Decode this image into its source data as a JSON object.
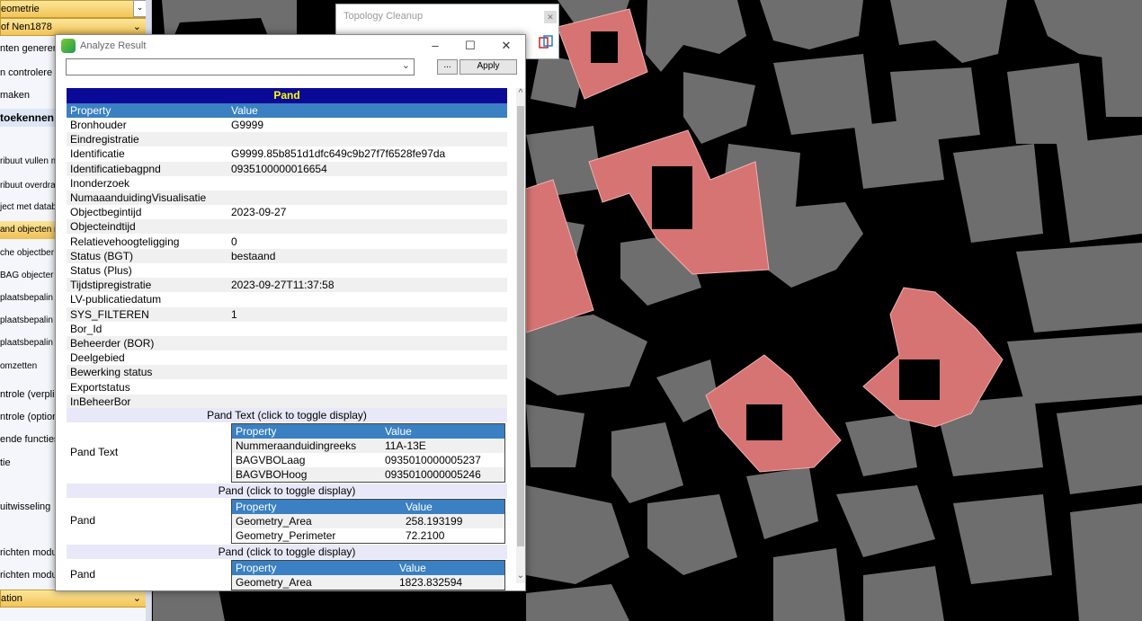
{
  "sidebar": {
    "items": [
      {
        "label": "eometrie",
        "kind": "header"
      },
      {
        "label": "of Nen1878",
        "kind": "header"
      },
      {
        "label": "nten generer",
        "kind": "plain"
      },
      {
        "label": "n controlere",
        "kind": "plain"
      },
      {
        "label": "maken",
        "kind": "plain"
      },
      {
        "label": "toekennen",
        "kind": "bold"
      },
      {
        "label": "ribuut vullen m",
        "kind": "small"
      },
      {
        "label": "ribuut overdra",
        "kind": "small"
      },
      {
        "label": "ject met datab",
        "kind": "small"
      },
      {
        "label": "and objecten m",
        "kind": "selected"
      },
      {
        "label": "che objectber",
        "kind": "small"
      },
      {
        "label": "BAG objecter",
        "kind": "small"
      },
      {
        "label": "plaatsbepalin",
        "kind": "small"
      },
      {
        "label": "plaatsbepalin",
        "kind": "small"
      },
      {
        "label": "plaatsbepalin",
        "kind": "small"
      },
      {
        "label": "omzetten",
        "kind": "small"
      },
      {
        "label": "ntrole (verpli",
        "kind": "plain"
      },
      {
        "label": "ntrole (option",
        "kind": "plain"
      },
      {
        "label": "ende functies",
        "kind": "plain"
      },
      {
        "label": "tie",
        "kind": "plain"
      },
      {
        "label": "uitwisseling",
        "kind": "plain"
      },
      {
        "label": "richten modu",
        "kind": "plain"
      },
      {
        "label": "richten modu",
        "kind": "plain"
      },
      {
        "label": "ation",
        "kind": "header"
      }
    ]
  },
  "topology": {
    "title": "Topology Cleanup"
  },
  "analyze": {
    "title": "Analyze Result",
    "combo_value": "",
    "ellipsis_label": "...",
    "apply_label": "Apply",
    "table_title": "Pand",
    "header": {
      "property": "Property",
      "value": "Value"
    },
    "rows": [
      {
        "property": "Bronhouder",
        "value": "G9999"
      },
      {
        "property": "Eindregistratie",
        "value": ""
      },
      {
        "property": "Identificatie",
        "value": "G9999.85b851d1dfc649c9b27f7f6528fe97da"
      },
      {
        "property": "Identificatiebagpnd",
        "value": "0935100000016654"
      },
      {
        "property": "Inonderzoek",
        "value": ""
      },
      {
        "property": "NumaaanduidingVisualisatie",
        "value": ""
      },
      {
        "property": "Objectbegintijd",
        "value": "2023-09-27"
      },
      {
        "property": "Objecteindtijd",
        "value": ""
      },
      {
        "property": "Relatievehoogteligging",
        "value": "0"
      },
      {
        "property": "Status (BGT)",
        "value": "bestaand"
      },
      {
        "property": "Status (Plus)",
        "value": ""
      },
      {
        "property": "Tijdstipregistratie",
        "value": "2023-09-27T11:37:58"
      },
      {
        "property": "LV-publicatiedatum",
        "value": ""
      },
      {
        "property": "SYS_FILTEREN",
        "value": "1"
      },
      {
        "property": "Bor_Id",
        "value": ""
      },
      {
        "property": "Beheerder (BOR)",
        "value": ""
      },
      {
        "property": "Deelgebied",
        "value": ""
      },
      {
        "property": "Bewerking status",
        "value": ""
      },
      {
        "property": "Exportstatus",
        "value": ""
      },
      {
        "property": "InBeheerBor",
        "value": ""
      }
    ],
    "sections": [
      {
        "title": "Pand Text (click to toggle display)",
        "label": "Pand Text",
        "rows": [
          {
            "property": "Nummeraanduidingreeks",
            "value": "11A-13E"
          },
          {
            "property": "BAGVBOLaag",
            "value": "0935010000005237"
          },
          {
            "property": "BAGVBOHoog",
            "value": "0935010000005246"
          }
        ]
      },
      {
        "title": "Pand (click to toggle display)",
        "label": "Pand",
        "rows": [
          {
            "property": "Geometry_Area",
            "value": "258.193199"
          },
          {
            "property": "Geometry_Perimeter",
            "value": "72.2100"
          }
        ]
      },
      {
        "title": "Pand (click to toggle display)",
        "label": "Pand",
        "rows": [
          {
            "property": "Geometry_Area",
            "value": "1823.832594"
          }
        ]
      }
    ]
  },
  "colors": {
    "map_bg": "#000000",
    "building_grey": "#6e6e6e",
    "building_red": "#d67373",
    "table_title_bg": "#0a0a96",
    "table_title_fg": "#ffff00",
    "header_bg": "#3a80c2"
  }
}
